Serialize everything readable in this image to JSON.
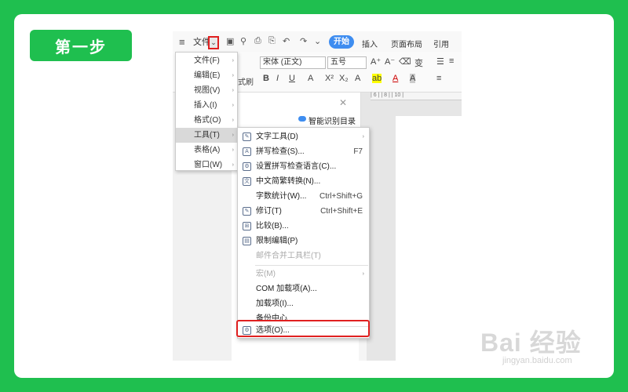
{
  "step_label": "第一步",
  "toolbar": {
    "menu_icon": "≡",
    "file_label": "文件",
    "chevron": "⌄",
    "quick_icons": [
      "▣",
      "⚲",
      "⎙",
      "⎘",
      "↶",
      "↷",
      "⌄"
    ],
    "tabs": [
      "开始",
      "插入",
      "页面布局",
      "引用"
    ]
  },
  "ribbon": {
    "format_painter": "式刷",
    "font_name": "宋体 (正文)",
    "font_size": "五号",
    "row1_icons": [
      "A⁺",
      "A⁻",
      "⌫",
      "变",
      "☰",
      "≡"
    ],
    "row2_icons": [
      "B",
      "I",
      "U",
      "A",
      "X²",
      "X₂",
      "A",
      "ab",
      "A",
      "A",
      "≡"
    ]
  },
  "nav_panel": {
    "close": "✕",
    "smart_toc": "智能识别目录"
  },
  "ruler_text": "| 6 | | 8 | | 10 |",
  "menu1": [
    {
      "label": "文件(F)",
      "arrow": "›"
    },
    {
      "label": "编辑(E)",
      "arrow": "›"
    },
    {
      "label": "视图(V)",
      "arrow": "›"
    },
    {
      "label": "插入(I)",
      "arrow": "›"
    },
    {
      "label": "格式(O)",
      "arrow": "›"
    },
    {
      "label": "工具(T)",
      "arrow": "›",
      "selected": true
    },
    {
      "label": "表格(A)",
      "arrow": "›"
    },
    {
      "label": "窗口(W)",
      "arrow": "›"
    }
  ],
  "menu2": [
    {
      "label": "文字工具(D)",
      "icon": "✎",
      "arrow": "›"
    },
    {
      "label": "拼写检查(S)...",
      "icon": "A",
      "shortcut": "F7"
    },
    {
      "label": "设置拼写检查语言(C)...",
      "icon": "⚙"
    },
    {
      "label": "中文简繁转换(N)...",
      "icon": "文"
    },
    {
      "label": "字数统计(W)...",
      "shortcut": "Ctrl+Shift+G"
    },
    {
      "label": "修订(T)",
      "icon": "✎",
      "shortcut": "Ctrl+Shift+E"
    },
    {
      "label": "比较(B)...",
      "icon": "⊞"
    },
    {
      "label": "限制编辑(P)",
      "icon": "▤"
    },
    {
      "label": "邮件合并工具栏(T)",
      "disabled": true
    },
    {
      "label": "宏(M)",
      "arrow": "›",
      "disabled": true
    },
    {
      "label": "COM 加载项(A)..."
    },
    {
      "label": "加载项(I)..."
    },
    {
      "label": "备份中心"
    },
    {
      "label": "选项(O)...",
      "icon": "⚙"
    }
  ],
  "watermark": {
    "main": "Bai 经验",
    "sub": "jingyan.baidu.com"
  }
}
